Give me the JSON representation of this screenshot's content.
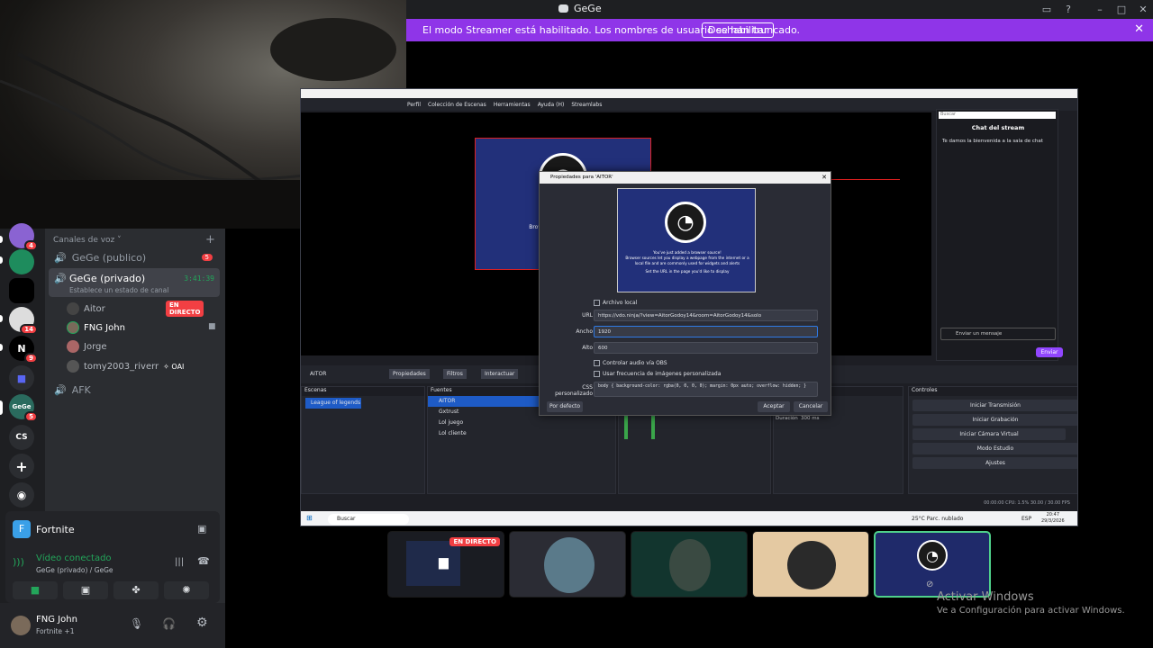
{
  "titlebar": {
    "title": "GeGe"
  },
  "banner": {
    "text": "El modo Streamer está habilitado. Los nombres de usuario se han truncado.",
    "button": "Deshabilitar"
  },
  "servers": [
    {
      "label": "",
      "badge": "4"
    },
    {
      "label": "",
      "badge": ""
    },
    {
      "label": "",
      "badge": ""
    },
    {
      "label": "",
      "badge": "14"
    },
    {
      "label": "N",
      "badge": "9"
    },
    {
      "label": "",
      "badge": ""
    },
    {
      "label": "GeGe",
      "badge": "5"
    },
    {
      "label": "CS",
      "badge": ""
    },
    {
      "label": "+",
      "badge": ""
    },
    {
      "label": "",
      "badge": ""
    }
  ],
  "channels": {
    "category": "Canales de voz",
    "public": {
      "name": "GeGe (publico)",
      "badge": "5"
    },
    "private": {
      "name": "GeGe (privado)",
      "timer": "3:41:39",
      "status": "Establece un estado de canal"
    },
    "users": [
      {
        "name": "Aitor",
        "live": "EN DIRECTO"
      },
      {
        "name": "FNG John"
      },
      {
        "name": "Jorge"
      },
      {
        "name": "tomy2003_riverr",
        "tag": "OAI"
      }
    ],
    "afk": "AFK"
  },
  "activity": {
    "game": "Fortnite"
  },
  "voice": {
    "status": "Vídeo conectado",
    "channel": "GeGe (privado) / GeGe"
  },
  "user": {
    "name": "FNG John",
    "status": "Fortnite +1"
  },
  "obs": {
    "menu": [
      "Perfil",
      "Colección de Escenas",
      "Herramientas",
      "Ayuda (H)",
      "Streamlabs"
    ],
    "scene_text": [
      "You've j",
      "Browser sources let you d",
      "file and are co",
      "Set the URL"
    ],
    "chat": {
      "search": "Buscar",
      "title": "Chat del stream",
      "welcome": "Te damos la bienvenida a la sala de chat",
      "placeholder": "Enviar un mensaje",
      "send": "Enviar"
    },
    "source_bar": {
      "name": "AITOR",
      "props": "Propiedades",
      "filters": "Filtros",
      "interact": "Interactuar"
    },
    "scenes": {
      "title": "Escenas",
      "items": [
        "League of legends"
      ]
    },
    "sources": {
      "title": "Fuentes",
      "items": [
        "AITOR",
        "Gxtrust",
        "Lol juego",
        "Lol cliente"
      ]
    },
    "transitions": {
      "title": "na",
      "duration_label": "Duración",
      "duration": "300 ms"
    },
    "controls": {
      "title": "Controles",
      "items": [
        "Iniciar Transmisión",
        "Iniciar Grabación",
        "Iniciar Cámara Virtual",
        "Modo Estudio",
        "Ajustes"
      ]
    },
    "status": "00:00:00   CPU: 1.5%  30.00 / 30.00 FPS",
    "taskbar": {
      "search": "Buscar",
      "weather": "25°C  Parc. nublado",
      "lang": "ESP",
      "time": "20:47",
      "date": "29/3/2026"
    }
  },
  "dialog": {
    "title": "Propiedades para 'AITOR'",
    "preview_lines": [
      "You've just added a browser source!",
      "Browser sources let you display a webpage from the internet or a local file and are commonly used for widgets and alerts",
      "Set the URL in the page you'd like to display"
    ],
    "local_file": "Archivo local",
    "url_label": "URL",
    "url": "https://vdo.ninja/?view=AitorGodoy14&room=AitorGodoy14&solo",
    "width_label": "Ancho",
    "width": "1920",
    "height_label": "Alto",
    "height": "600",
    "audio_ctrl": "Controlar audio vía OBS",
    "custom_fps": "Usar frecuencia de imágenes personalizada",
    "css_label": "CSS personalizado",
    "css": "body { background-color: rgba(0, 0, 0, 0); margin: 0px auto; overflow: hidden; }",
    "defaults": "Por defecto",
    "ok": "Aceptar",
    "cancel": "Cancelar"
  },
  "tiles": {
    "live": "EN DIRECTO"
  },
  "watermark": {
    "title": "Activar Windows",
    "sub": "Ve a Configuración para activar Windows."
  }
}
